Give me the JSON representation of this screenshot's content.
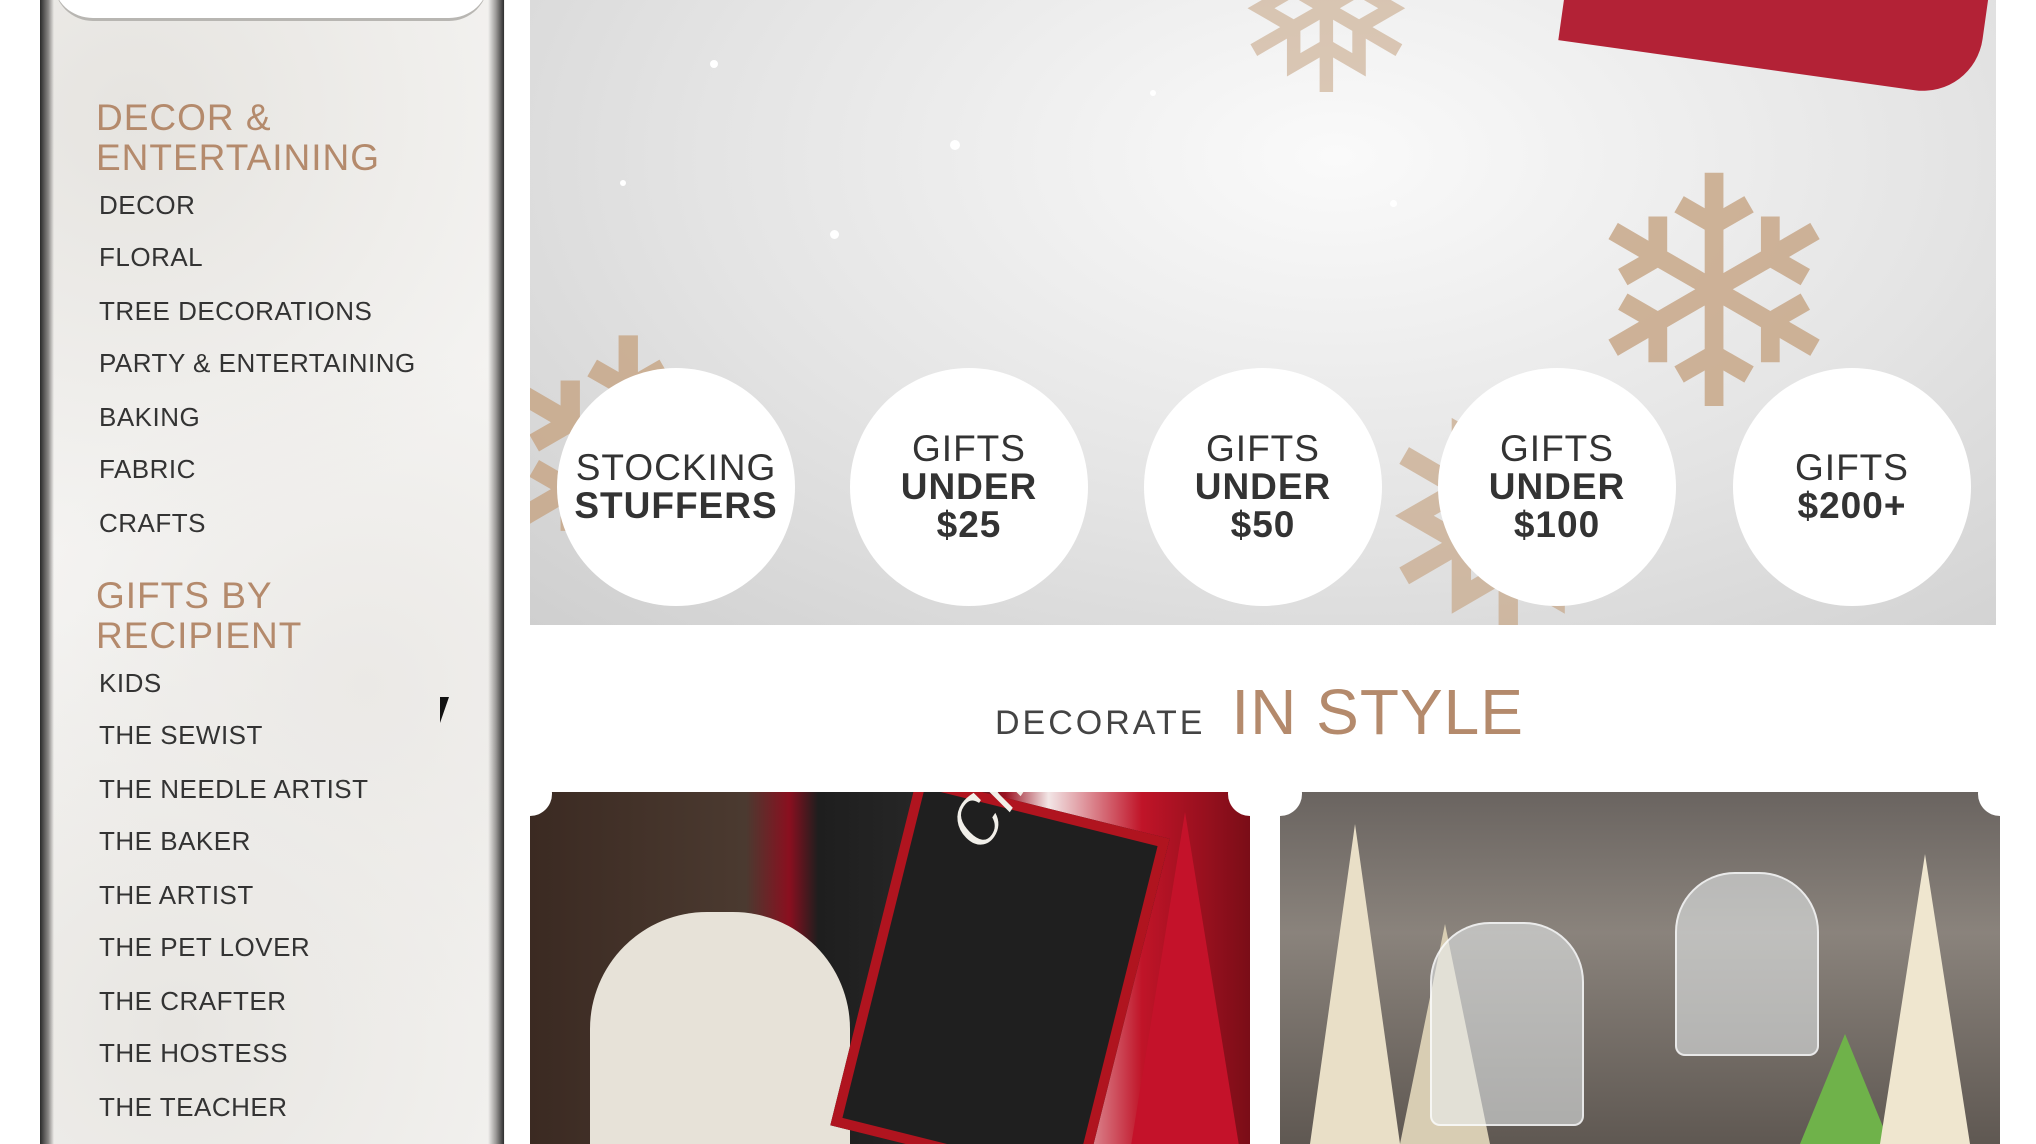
{
  "sidebar": {
    "sections": [
      {
        "heading": "DECOR & ENTERTAINING",
        "heading_lines": [
          "DECOR &",
          "ENTERTAINING"
        ],
        "items": [
          "DECOR",
          "FLORAL",
          "TREE DECORATIONS",
          "PARTY & ENTERTAINING",
          "BAKING",
          "FABRIC",
          "CRAFTS"
        ]
      },
      {
        "heading": "GIFTS BY RECIPIENT",
        "heading_lines": [
          "GIFTS BY",
          "RECIPIENT"
        ],
        "items": [
          "KIDS",
          "THE SEWIST",
          "THE NEEDLE ARTIST",
          "THE BAKER",
          "THE ARTIST",
          "THE PET LOVER",
          "THE CRAFTER",
          "THE HOSTESS",
          "THE TEACHER"
        ]
      }
    ]
  },
  "hero": {
    "gift_buttons": [
      {
        "line1": "STOCKING",
        "line2": "STUFFERS",
        "line3": ""
      },
      {
        "line1": "GIFTS",
        "line2": "UNDER",
        "line3": "$25"
      },
      {
        "line1": "GIFTS",
        "line2": "UNDER",
        "line3": "$50"
      },
      {
        "line1": "GIFTS",
        "line2": "UNDER",
        "line3": "$100"
      },
      {
        "line1": "GIFTS",
        "line2": "$200+",
        "line3": ""
      }
    ]
  },
  "decorate": {
    "small": "DECORATE",
    "big": "IN STYLE"
  },
  "tiles": {
    "left_sign": "Christmas"
  },
  "colors": {
    "accent": "#b48a6c",
    "text": "#333333",
    "red": "#b32236"
  },
  "icons": [
    "mouse-pointer-icon",
    "snowflake-icon"
  ]
}
